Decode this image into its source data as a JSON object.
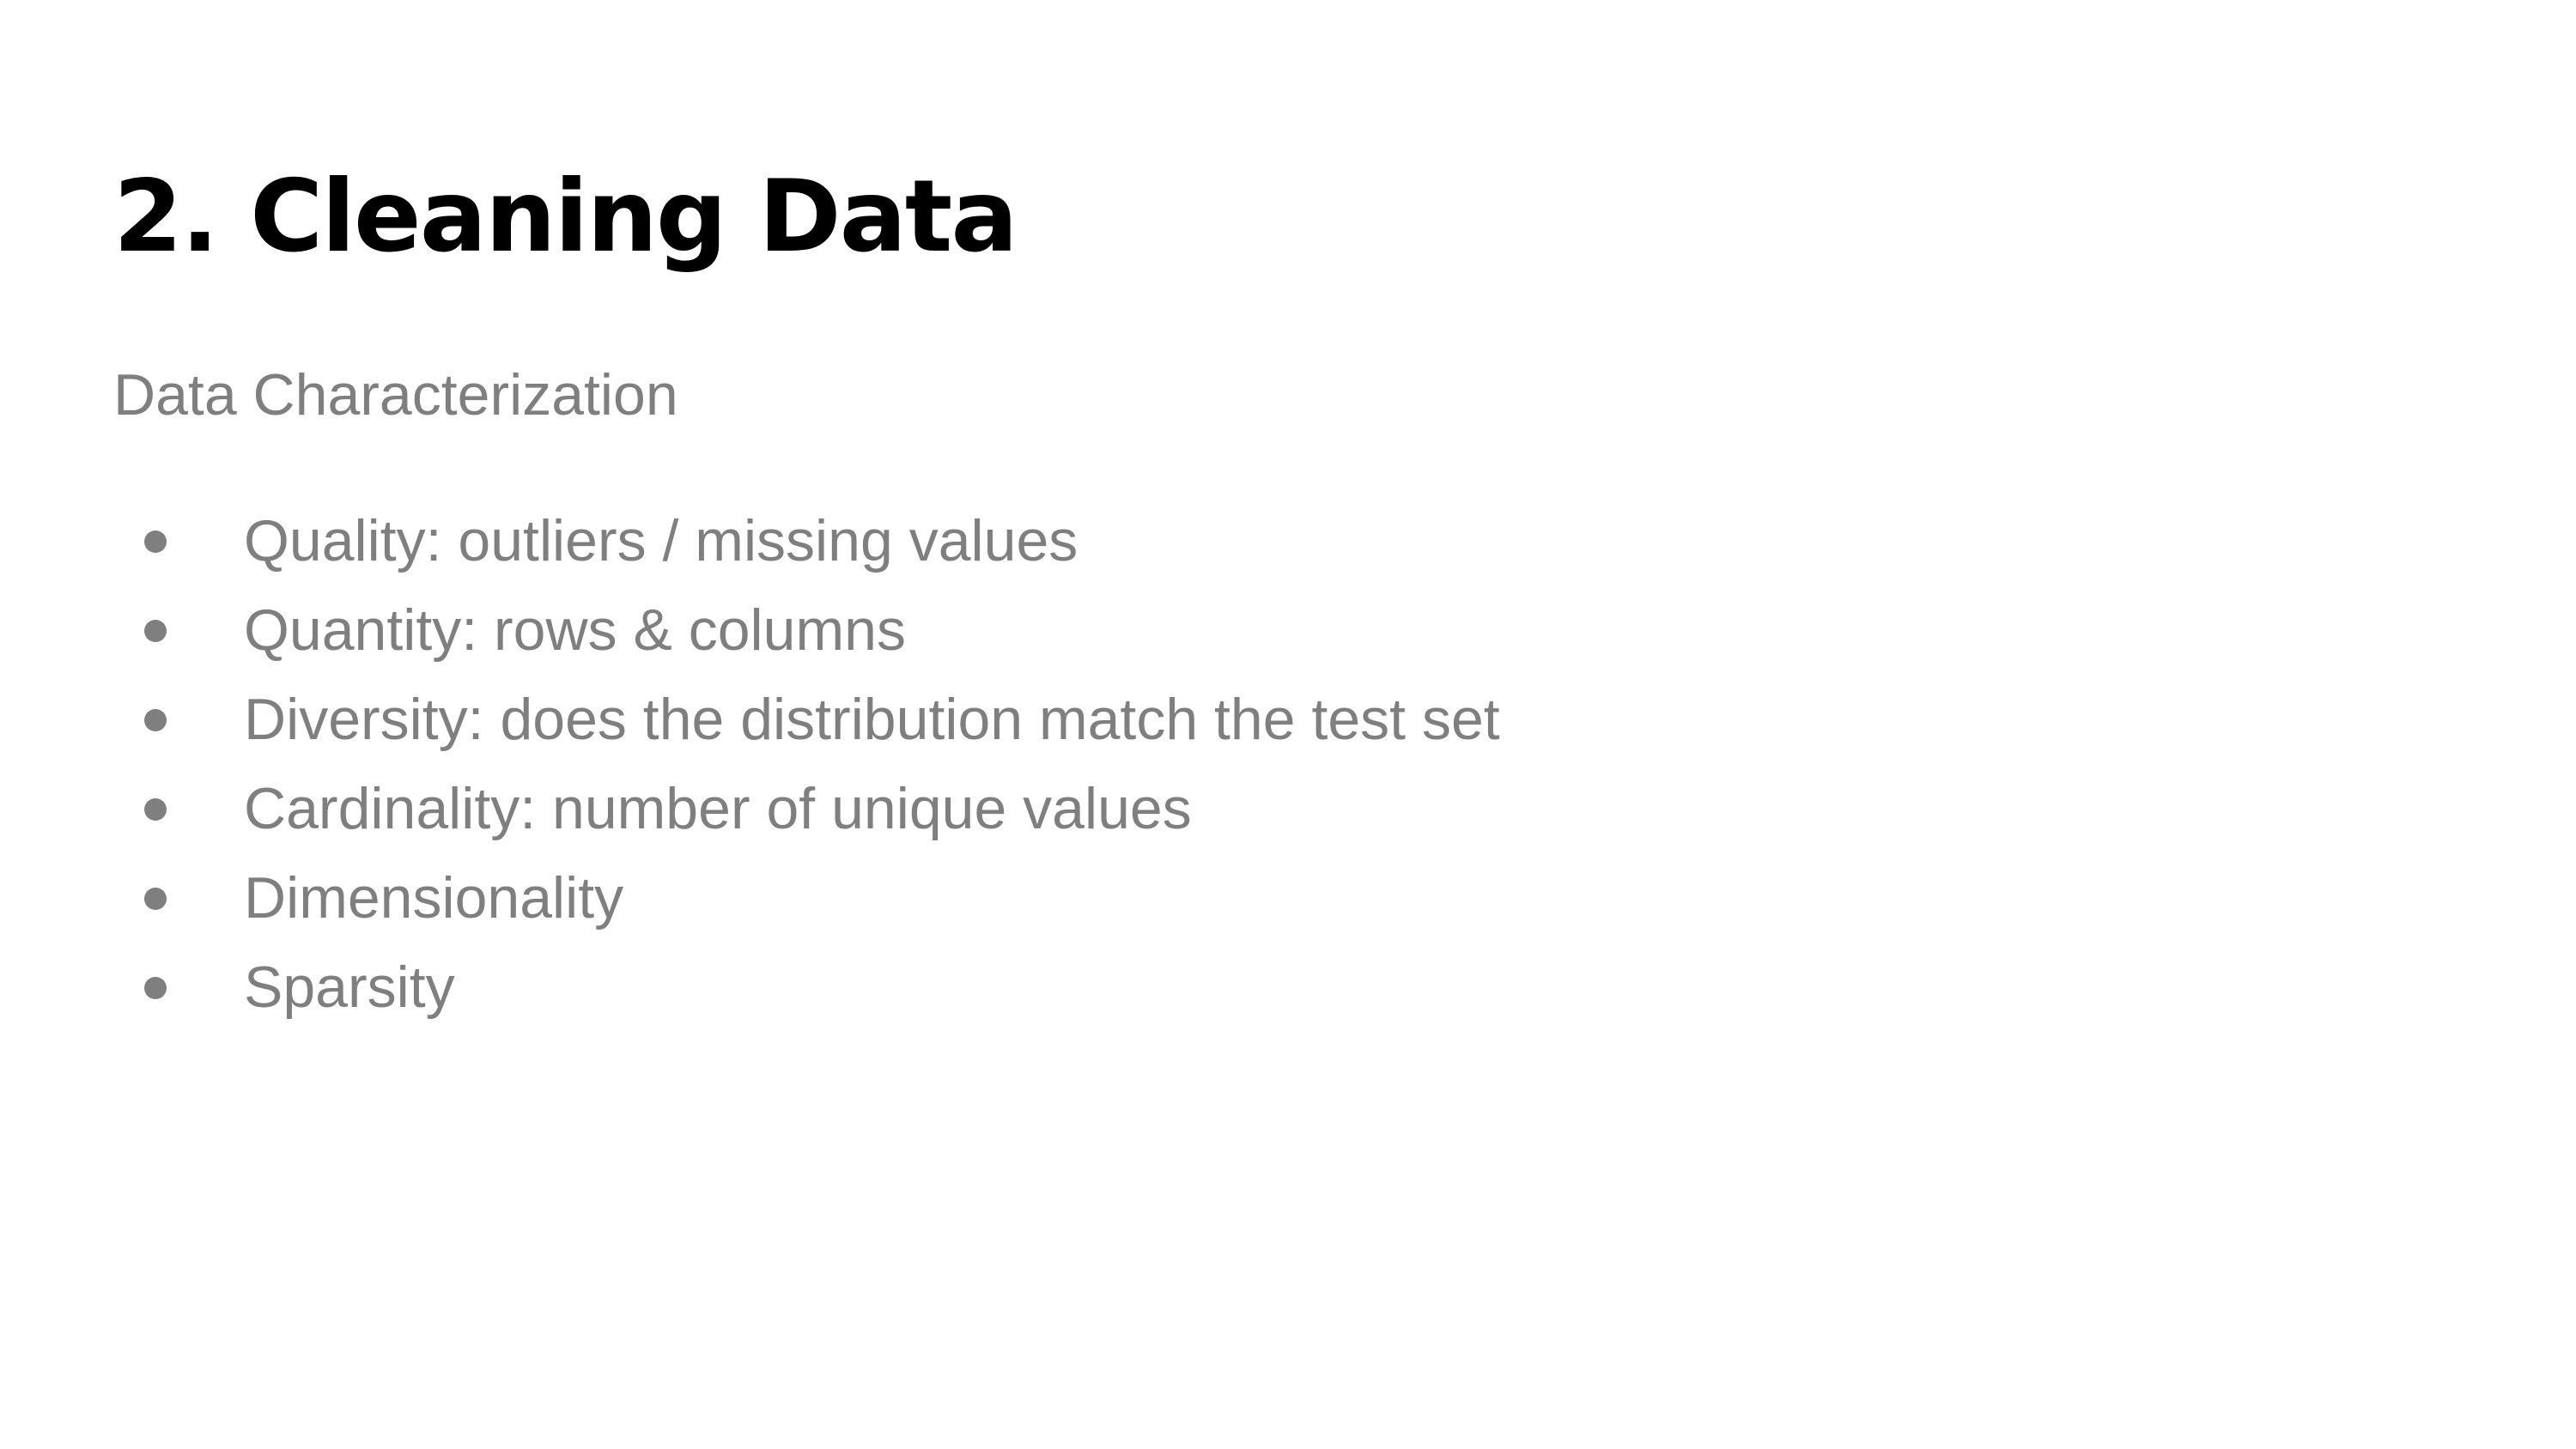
{
  "slide": {
    "title": "2. Cleaning Data",
    "subtitle": "Data Characterization",
    "bullets": [
      "Quality: outliers / missing values",
      "Quantity: rows & columns",
      "Diversity: does the distribution match the test set",
      "Cardinality: number of unique values",
      "Dimensionality",
      "Sparsity"
    ]
  },
  "colors": {
    "title": "#000000",
    "body": "#7f7f7f",
    "background": "#ffffff"
  }
}
